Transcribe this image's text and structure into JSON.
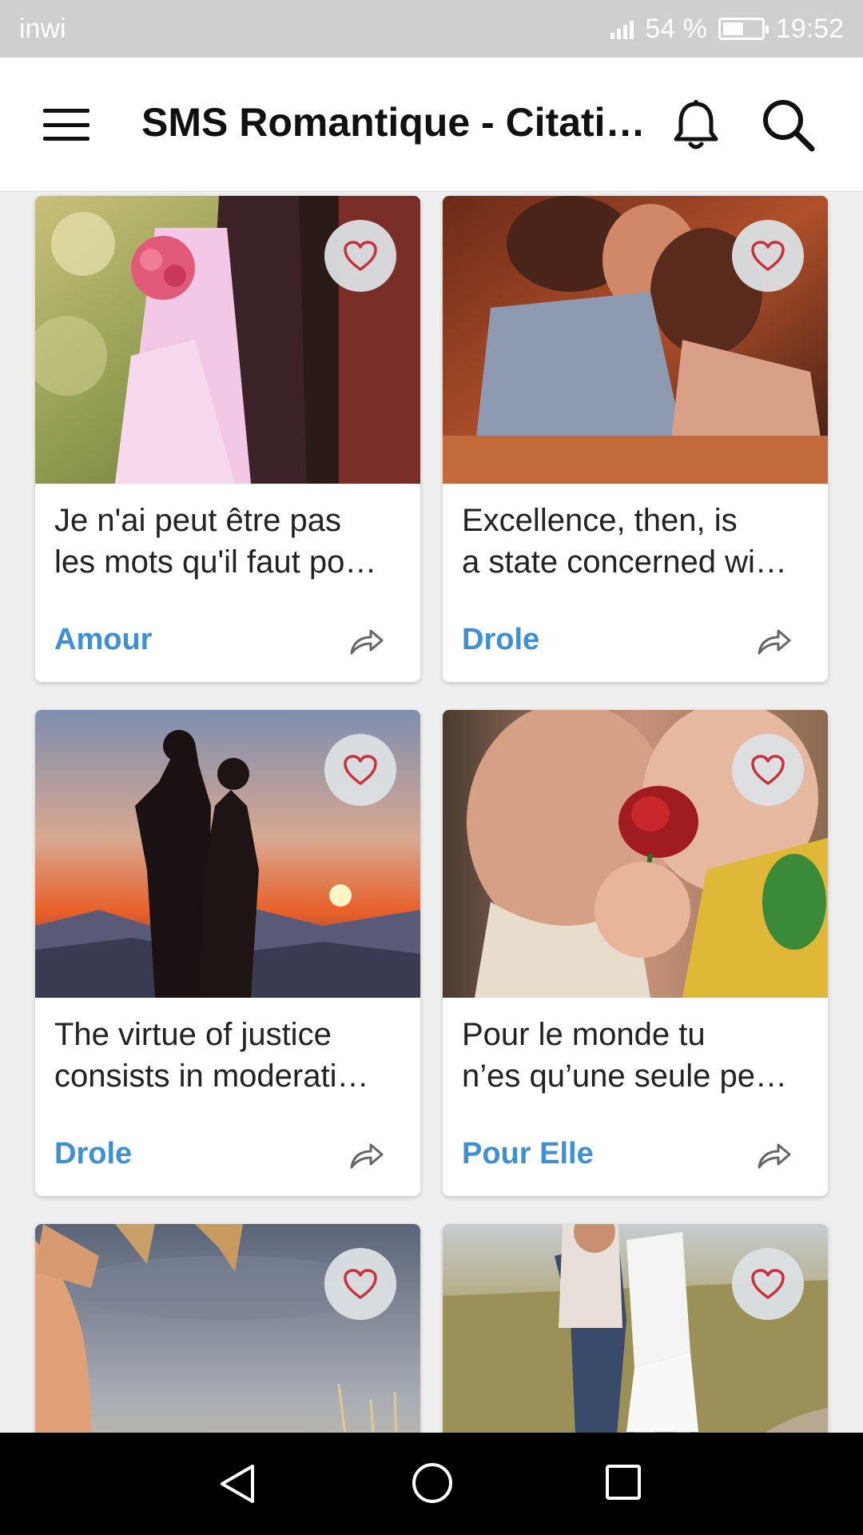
{
  "status_bar": {
    "carrier": "inwi",
    "battery_text": "54 %",
    "battery_level": 0.54,
    "time": "19:52"
  },
  "app_bar": {
    "title": "SMS Romantique - Citati…"
  },
  "accent_color": "#3f8fd2",
  "heart_color": "#c8323c",
  "cards": [
    {
      "line1": "Je n'ai peut être pas",
      "line2": "les mots qu'il faut po…",
      "category": "Amour"
    },
    {
      "line1": "Excellence, then, is",
      "line2": "a state concerned wi…",
      "category": "Drole"
    },
    {
      "line1": "The virtue of justice",
      "line2": "consists in moderati…",
      "category": "Drole"
    },
    {
      "line1": "Pour le monde tu",
      "line2": "n’es qu’une seule pe…",
      "category": "Pour Elle"
    },
    {
      "line1": "",
      "line2": "",
      "category": ""
    },
    {
      "line1": "",
      "line2": "",
      "category": ""
    }
  ],
  "icons": {
    "menu": "menu-icon",
    "notifications": "bell-icon",
    "search": "search-icon",
    "favorite": "heart-outline-icon",
    "share": "share-arrow-icon",
    "nav_back": "triangle-back-icon",
    "nav_home": "circle-home-icon",
    "nav_recent": "square-recent-icon"
  }
}
